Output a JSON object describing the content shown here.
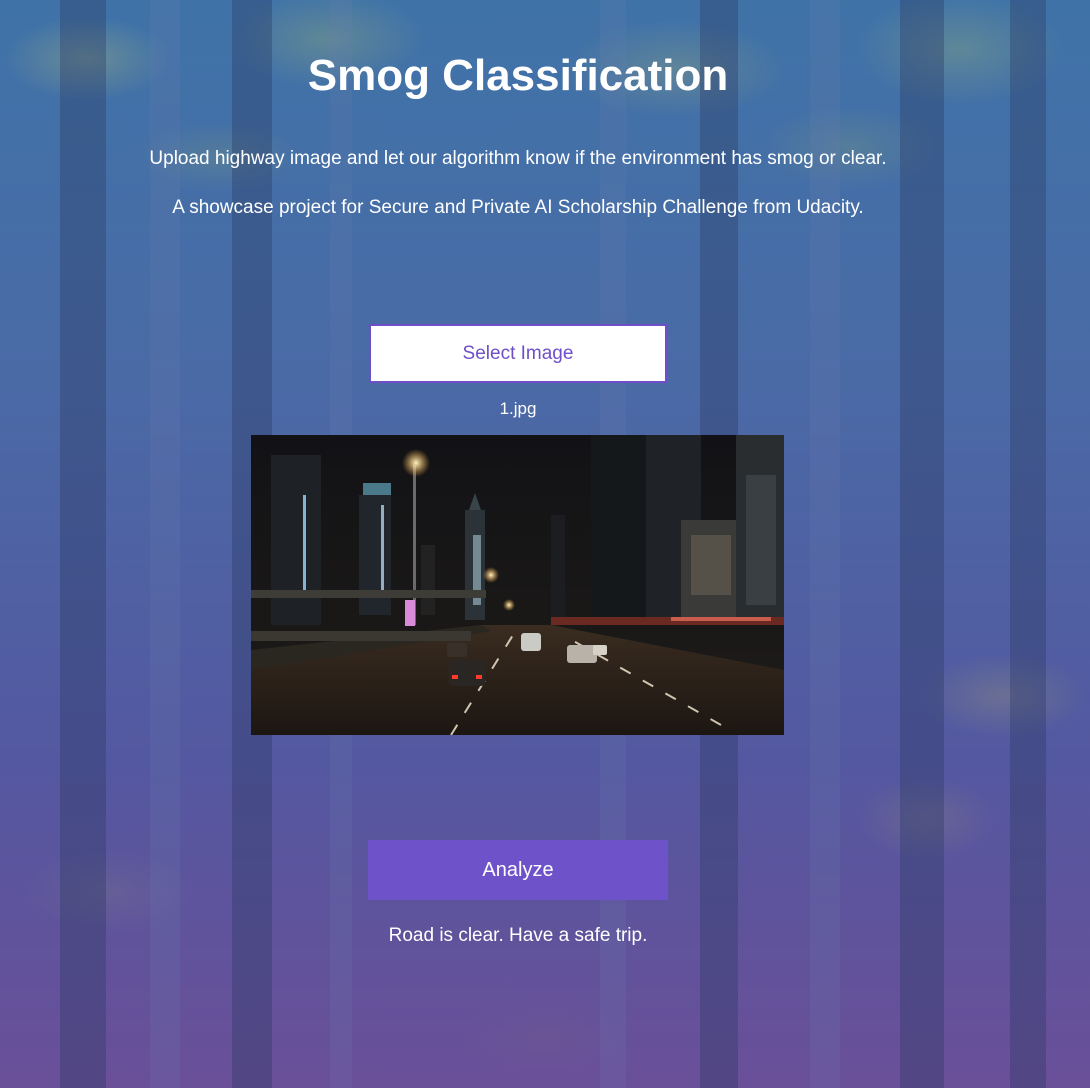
{
  "page": {
    "title": "Smog Classification",
    "description_line1": "Upload highway image and let our algorithm know if the environment has smog or clear.",
    "description_line2": "A showcase project for Secure and Private AI Scholarship Challenge from Udacity."
  },
  "upload": {
    "select_label": "Select Image",
    "file_name": "1.jpg"
  },
  "preview": {
    "icon": "highway-night-photo"
  },
  "analyze": {
    "label": "Analyze",
    "result": "Road is clear. Have a safe trip."
  },
  "colors": {
    "accent": "#6e52c9",
    "background_top": "#3f73a8",
    "background_bottom": "#6a4f99",
    "text": "#ffffff"
  }
}
